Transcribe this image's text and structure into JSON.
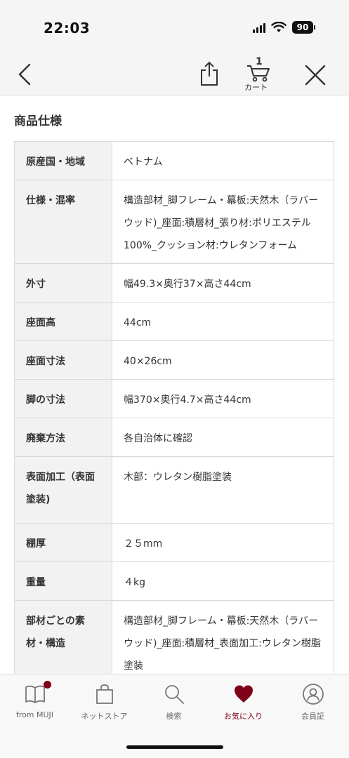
{
  "status_bar": {
    "time": "22:03",
    "battery": "90"
  },
  "nav": {
    "cart_count": "1",
    "cart_label": "カート"
  },
  "section": {
    "title": "商品仕様"
  },
  "specs": [
    {
      "key": "原産国・地域",
      "value": "ベトナム"
    },
    {
      "key": "仕様・混率",
      "value": "構造部材_脚フレーム・幕板:天然木（ラバーウッド)_座面:積層材_張り材:ポリエステル100%_クッション材:ウレタンフォーム"
    },
    {
      "key": "外寸",
      "value": "幅49.3×奥行37×高さ44cm"
    },
    {
      "key": "座面高",
      "value": "44cm"
    },
    {
      "key": "座面寸法",
      "value": "40×26cm"
    },
    {
      "key": "脚の寸法",
      "value": "幅370×奥行4.7×高さ44cm"
    },
    {
      "key": "廃棄方法",
      "value": "各自治体に確認"
    },
    {
      "key": "表面加工（表面塗装)",
      "value": "木部：ウレタン樹脂塗装"
    },
    {
      "key": "棚厚",
      "value": "２５mm"
    },
    {
      "key": "重量",
      "value": "４kg"
    },
    {
      "key": "部材ごとの素材・構造",
      "value": "構造部材_脚フレーム・幕板:天然木（ラバーウッド)_座面:積層材_表面加工:ウレタン樹脂塗装"
    }
  ],
  "tabs": [
    {
      "label": "from MUJI",
      "icon": "book-icon"
    },
    {
      "label": "ネットストア",
      "icon": "bag-icon"
    },
    {
      "label": "検索",
      "icon": "search-icon"
    },
    {
      "label": "お気に入り",
      "icon": "heart-icon"
    },
    {
      "label": "会員証",
      "icon": "member-card-icon"
    }
  ],
  "colors": {
    "accent": "#7f0019",
    "table_key_bg": "#f2f2f2",
    "border": "#d9d9d9"
  }
}
